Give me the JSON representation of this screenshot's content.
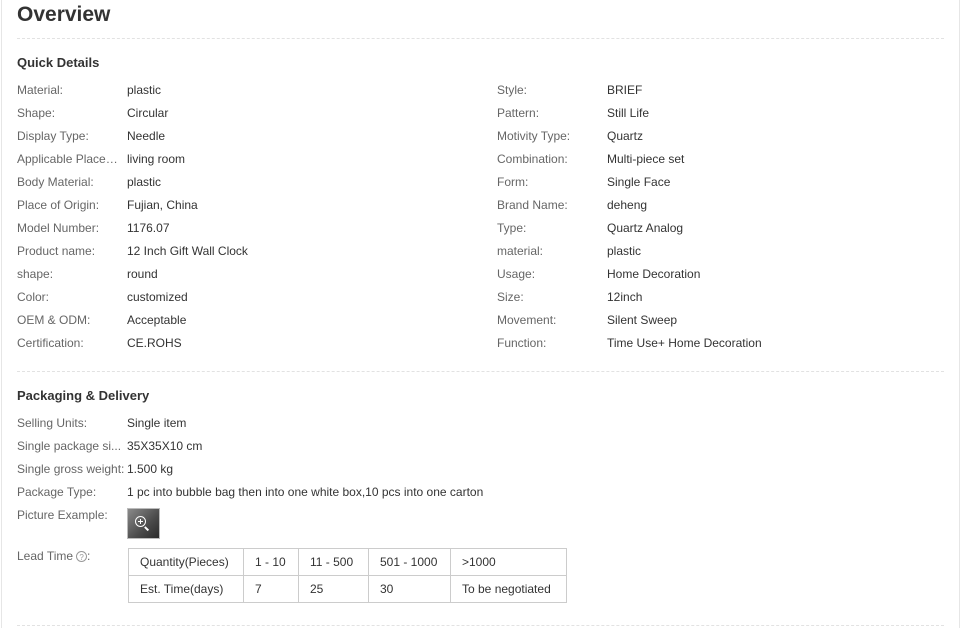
{
  "page_title": "Overview",
  "quick_details": {
    "title": "Quick Details",
    "left": [
      {
        "label": "Material:",
        "value": "plastic"
      },
      {
        "label": "Shape:",
        "value": "Circular"
      },
      {
        "label": "Display Type:",
        "value": "Needle"
      },
      {
        "label": "Applicable Placem...",
        "value": "living room"
      },
      {
        "label": "Body Material:",
        "value": "plastic"
      },
      {
        "label": "Place of Origin:",
        "value": "Fujian, China"
      },
      {
        "label": "Model Number:",
        "value": "1176.07"
      },
      {
        "label": "Product name:",
        "value": "12 Inch Gift Wall Clock"
      },
      {
        "label": "shape:",
        "value": "round"
      },
      {
        "label": "Color:",
        "value": "customized"
      },
      {
        "label": "OEM & ODM:",
        "value": "Acceptable"
      },
      {
        "label": "Certification:",
        "value": "CE.ROHS"
      }
    ],
    "right": [
      {
        "label": "Style:",
        "value": "BRIEF"
      },
      {
        "label": "Pattern:",
        "value": "Still Life"
      },
      {
        "label": "Motivity Type:",
        "value": "Quartz"
      },
      {
        "label": "Combination:",
        "value": "Multi-piece set"
      },
      {
        "label": "Form:",
        "value": "Single Face"
      },
      {
        "label": "Brand Name:",
        "value": "deheng"
      },
      {
        "label": "Type:",
        "value": "Quartz Analog"
      },
      {
        "label": "material:",
        "value": "plastic"
      },
      {
        "label": "Usage:",
        "value": "Home Decoration"
      },
      {
        "label": "Size:",
        "value": "12inch"
      },
      {
        "label": "Movement:",
        "value": "Silent Sweep"
      },
      {
        "label": "Function:",
        "value": "Time Use+ Home Decoration"
      }
    ]
  },
  "packaging": {
    "title": "Packaging & Delivery",
    "rows": [
      {
        "label": "Selling Units:",
        "value": "Single item"
      },
      {
        "label": "Single package si...",
        "value": "35X35X10 cm"
      },
      {
        "label": "Single gross weight:",
        "value": "1.500 kg"
      },
      {
        "label": "Package Type:",
        "value": "1 pc into bubble bag then into one white box,10 pcs into one carton"
      }
    ],
    "picture_label": "Picture Example:",
    "picture_icon": "zoom-in-icon",
    "lead_time_label": "Lead Time",
    "lead_time_help": "?",
    "lead_time_suffix": ":",
    "lead_table": {
      "header": [
        "Quantity(Pieces)",
        "1 - 10",
        "11 - 500",
        "501 - 1000",
        ">1000"
      ],
      "row": [
        "Est. Time(days)",
        "7",
        "25",
        "30",
        "To be negotiated"
      ]
    }
  }
}
